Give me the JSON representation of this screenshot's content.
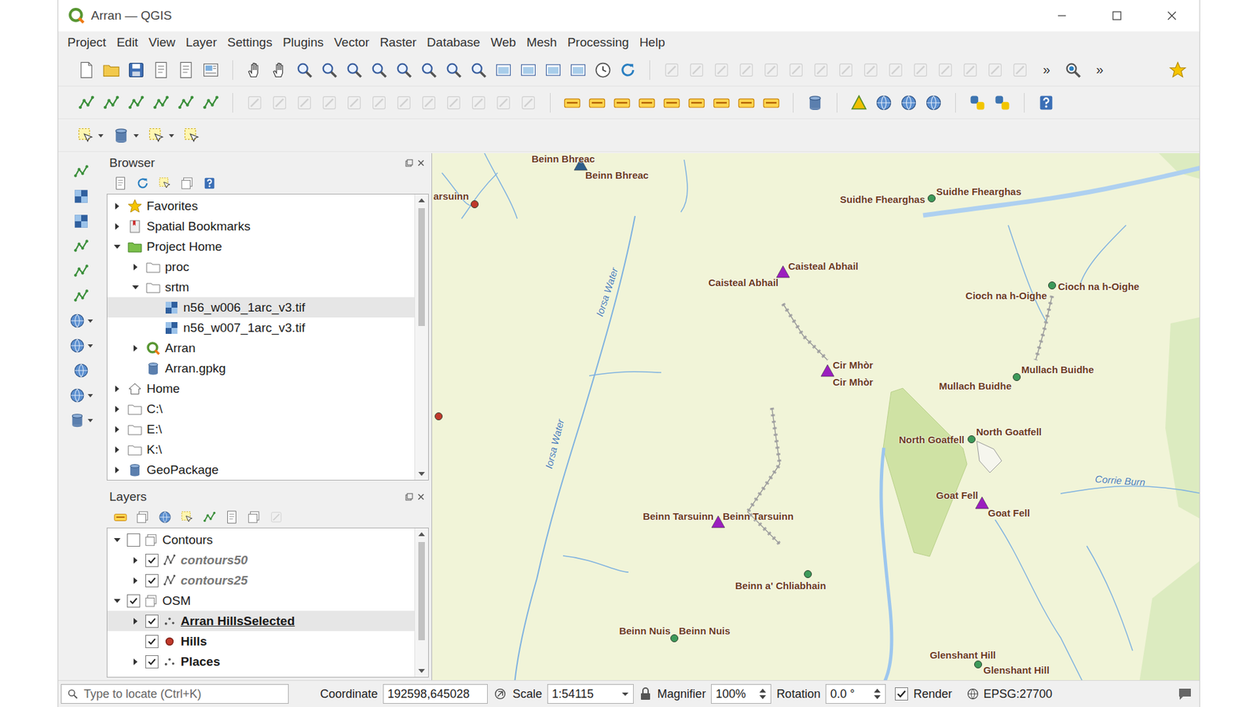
{
  "window": {
    "title": "Arran — QGIS"
  },
  "menu": [
    "Project",
    "Edit",
    "View",
    "Layer",
    "Settings",
    "Plugins",
    "Vector",
    "Raster",
    "Database",
    "Web",
    "Mesh",
    "Processing",
    "Help"
  ],
  "toolbar_overflow": [
    "»",
    "»"
  ],
  "browser": {
    "title": "Browser",
    "items": [
      {
        "label": "Favorites",
        "kind": "favorites",
        "expandable": true,
        "expanded": false,
        "selected": false
      },
      {
        "label": "Spatial Bookmarks",
        "kind": "bookmarks",
        "expandable": true,
        "expanded": false,
        "selected": false
      },
      {
        "label": "Project Home",
        "kind": "project-home",
        "expandable": true,
        "expanded": true,
        "selected": false,
        "children": [
          {
            "label": "proc",
            "kind": "folder",
            "expandable": true,
            "expanded": false,
            "selected": false
          },
          {
            "label": "srtm",
            "kind": "folder",
            "expandable": true,
            "expanded": true,
            "selected": false,
            "children": [
              {
                "label": "n56_w006_1arc_v3.tif",
                "kind": "raster",
                "expandable": false,
                "expanded": false,
                "selected": true
              },
              {
                "label": "n56_w007_1arc_v3.tif",
                "kind": "raster",
                "expandable": false,
                "expanded": false,
                "selected": false
              }
            ]
          },
          {
            "label": "Arran",
            "kind": "qgis-project",
            "expandable": true,
            "expanded": false,
            "selected": false
          },
          {
            "label": "Arran.gpkg",
            "kind": "geopackage-file",
            "expandable": false,
            "expanded": false,
            "selected": false
          }
        ]
      },
      {
        "label": "Home",
        "kind": "home",
        "expandable": true,
        "expanded": false,
        "selected": false
      },
      {
        "label": "C:\\",
        "kind": "drive",
        "expandable": true,
        "expanded": false,
        "selected": false
      },
      {
        "label": "E:\\",
        "kind": "drive",
        "expandable": true,
        "expanded": false,
        "selected": false
      },
      {
        "label": "K:\\",
        "kind": "drive",
        "expandable": true,
        "expanded": false,
        "selected": false
      },
      {
        "label": "GeoPackage",
        "kind": "geopackage",
        "expandable": true,
        "expanded": false,
        "selected": false
      }
    ]
  },
  "layers": {
    "title": "Layers",
    "items": [
      {
        "label": "Contours",
        "kind": "group",
        "expandable": true,
        "expanded": true,
        "checked": false,
        "dimmed": false,
        "emphasized": false,
        "current": false,
        "children": [
          {
            "label": "contours50",
            "kind": "line",
            "expandable": true,
            "expanded": false,
            "checked": true,
            "dimmed": true,
            "emphasized": true,
            "current": false
          },
          {
            "label": "contours25",
            "kind": "line",
            "expandable": true,
            "expanded": false,
            "checked": true,
            "dimmed": true,
            "emphasized": true,
            "current": false
          }
        ]
      },
      {
        "label": "OSM",
        "kind": "group",
        "expandable": true,
        "expanded": true,
        "checked": true,
        "dimmed": false,
        "emphasized": false,
        "current": false,
        "children": [
          {
            "label": "Arran HillsSelected",
            "kind": "point",
            "expandable": true,
            "expanded": false,
            "checked": true,
            "dimmed": false,
            "emphasized": true,
            "current": true
          },
          {
            "label": "Hills",
            "kind": "symbol",
            "expandable": false,
            "expanded": false,
            "checked": true,
            "dimmed": false,
            "emphasized": true,
            "current": false
          },
          {
            "label": "Places",
            "kind": "point",
            "expandable": true,
            "expanded": false,
            "checked": true,
            "dimmed": false,
            "emphasized": true,
            "current": false
          }
        ]
      }
    ]
  },
  "map": {
    "features": [
      {
        "kind": "triangle",
        "color": "#2d5f8c"
      },
      {
        "kind": "dot",
        "color": "#c0392b"
      },
      {
        "kind": "dot",
        "color": "#c0392b"
      },
      {
        "kind": "dot",
        "color": "#3d9a5a"
      },
      {
        "kind": "triangle",
        "color": "#9b1fbf"
      },
      {
        "kind": "dot",
        "color": "#3d9a5a"
      },
      {
        "kind": "triangle",
        "color": "#9b1fbf"
      },
      {
        "kind": "dot",
        "color": "#3d9a5a"
      },
      {
        "kind": "dot",
        "color": "#3d9a5a"
      },
      {
        "kind": "triangle",
        "color": "#9b1fbf"
      },
      {
        "kind": "triangle",
        "color": "#9b1fbf"
      },
      {
        "kind": "dot",
        "color": "#3d9a5a"
      },
      {
        "kind": "dot",
        "color": "#3d9a5a"
      },
      {
        "kind": "dot",
        "color": "#3d9a5a"
      }
    ],
    "labels": [
      "Beinn Bhreac",
      "Beinn Bhreac",
      "arsuinn",
      "Suidhe Fhearghas",
      "Suidhe Fhearghas",
      "Caisteal Abhail",
      "Caisteal Abhail",
      "Cioch na h-Oighe",
      "Cioch na h-Oighe",
      "Cir Mhòr",
      "Cir Mhòr",
      "Mullach Buidhe",
      "Mullach Buidhe",
      "North Goatfell",
      "North Goatfell",
      "Goat Fell",
      "Goat Fell",
      "Beinn Tarsuinn",
      "Beinn Tarsuinn",
      "Beinn a' Chliabhain",
      "Beinn Nuis",
      "Beinn Nuis",
      "Glenshant Hill",
      "Glenshant Hill"
    ],
    "water_labels": [
      "Iorsa Water",
      "Iorsa Water",
      "Corrie Burn"
    ]
  },
  "status_bar": {
    "locate_placeholder": "Type to locate (Ctrl+K)",
    "coordinate_label": "Coordinate",
    "coordinate": "192598,645028",
    "scale_label": "Scale",
    "scale": "1:54115",
    "magnifier_label": "Magnifier",
    "magnifier": "100%",
    "rotation_label": "Rotation",
    "rotation": "0.0 °",
    "render_label": "Render",
    "render_checked": true,
    "crs": "EPSG:27700"
  }
}
